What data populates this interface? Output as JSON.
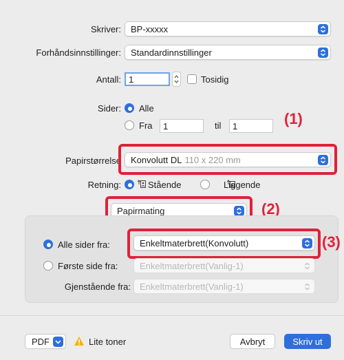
{
  "printer": {
    "label": "Skriver:",
    "value": "BP-xxxxx"
  },
  "presets": {
    "label": "Forhåndsinnstillinger:",
    "value": "Standardinnstillinger"
  },
  "copies": {
    "label": "Antall:",
    "value": "1",
    "two_sided_label": "Tosidig"
  },
  "pages": {
    "label": "Sider:",
    "all_label": "Alle",
    "from_label": "Fra",
    "from_value": "1",
    "to_label": "til",
    "to_value": "1"
  },
  "paper_size": {
    "label": "Papirstørrelse",
    "name": "Konvolutt DL",
    "dimensions": "110 x 220 mm"
  },
  "orientation": {
    "label": "Retning:",
    "portrait_label": "Stående",
    "landscape_label": "Liggende"
  },
  "section_menu": {
    "value": "Papirmating"
  },
  "paper_feed": {
    "all_pages_label": "Alle sider fra:",
    "all_pages_value": "Enkeltmaterbrett(Konvolutt)",
    "first_page_label": "Første side fra:",
    "first_page_value": "Enkeltmaterbrett(Vanlig-1)",
    "remaining_label": "Gjenstående fra:",
    "remaining_value": "Enkeltmaterbrett(Vanlig-1)"
  },
  "footer": {
    "pdf_label": "PDF",
    "warning_label": "Lite toner",
    "cancel_label": "Avbryt",
    "print_label": "Skriv ut"
  },
  "callouts": {
    "c1": "(1)",
    "c2": "(2)",
    "c3": "(3)"
  },
  "colors": {
    "accent": "#2f6fdc",
    "highlight": "#e0213a",
    "warning": "#f5b400"
  }
}
